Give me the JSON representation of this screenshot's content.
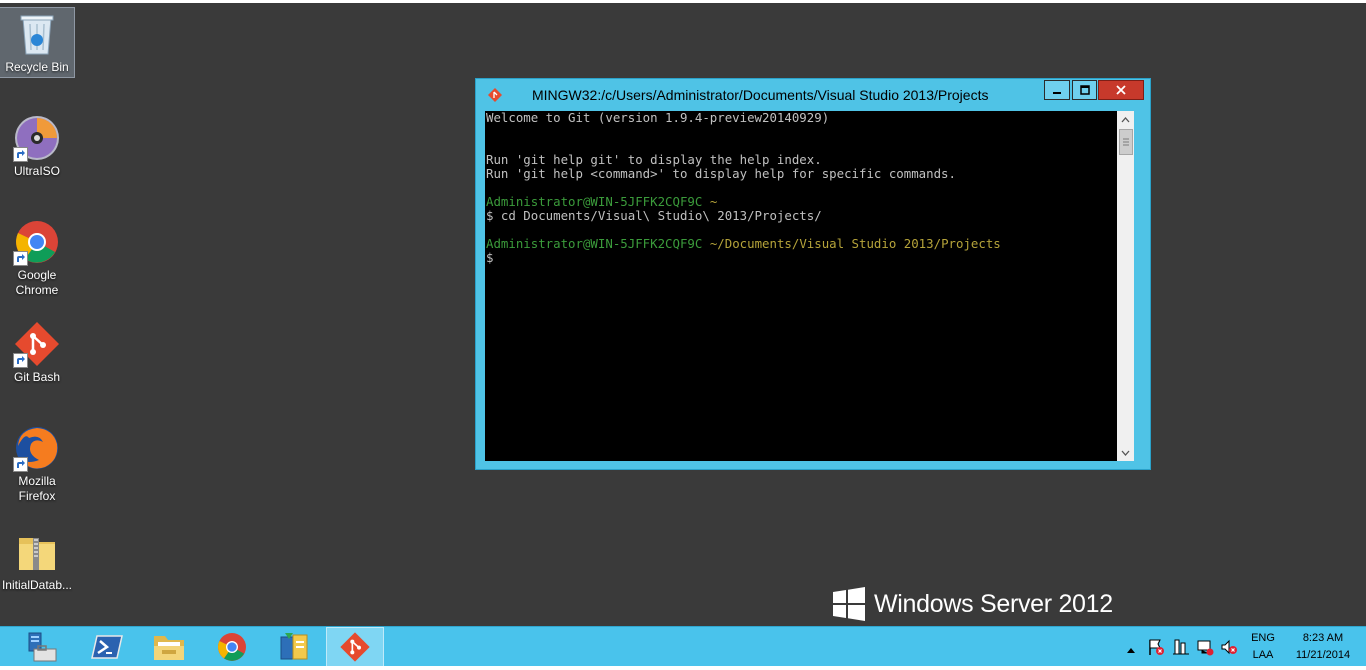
{
  "desktop": {
    "icons": [
      {
        "label": "Recycle Bin"
      },
      {
        "label": "UltraISO"
      },
      {
        "label": "Google Chrome"
      },
      {
        "label": "Git Bash"
      },
      {
        "label": "Mozilla Firefox"
      },
      {
        "label": "InitialDatab..."
      }
    ]
  },
  "window": {
    "title": "MINGW32:/c/Users/Administrator/Documents/Visual Studio 2013/Projects",
    "buttons": {
      "minimize": "minimize",
      "maximize": "maximize",
      "close": "close"
    },
    "console": {
      "lines": [
        "Welcome to Git (version 1.9.4-preview20140929)",
        "",
        "",
        "Run 'git help git' to display the help index.",
        "Run 'git help <command>' to display help for specific commands.",
        "",
        "$ cd Documents/Visual\\ Studio\\ 2013/Projects/",
        "",
        "$"
      ],
      "prompt1_user": "Administrator@WIN-5JFFK2CQF9C",
      "prompt1_path": "~",
      "prompt2_user": "Administrator@WIN-5JFFK2CQF9C",
      "prompt2_path": "~/Documents/Visual Studio 2013/Projects"
    }
  },
  "brand": {
    "text": "Windows Server 2012"
  },
  "taskbar": {
    "apps": [
      "server-manager",
      "powershell",
      "file-explorer",
      "google-chrome",
      "network-tool",
      "git-bash"
    ],
    "tray": {
      "lang_line1": "ENG",
      "lang_line2": "LAA",
      "time": "8:23 AM",
      "date": "11/21/2014"
    }
  },
  "colors": {
    "desktop": "#3a3a3a",
    "window_frame": "#4fc3e6",
    "taskbar": "#49c3ec",
    "close_button": "#c7392b",
    "prompt_user": "#3b9b3b",
    "prompt_path": "#b5a33a"
  }
}
